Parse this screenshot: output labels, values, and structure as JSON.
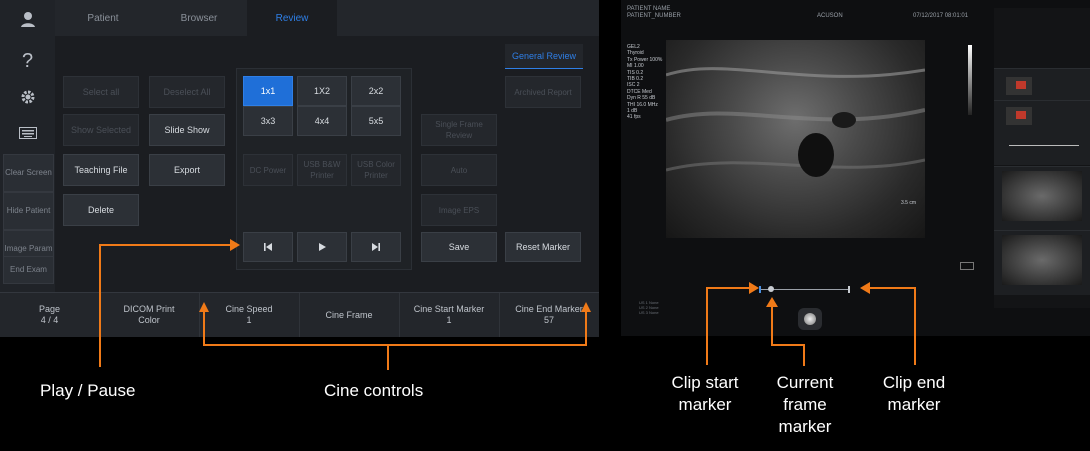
{
  "left_ui": {
    "tabs": [
      "Patient",
      "Browser",
      "Review"
    ],
    "active_tab": "Review",
    "general_review": "General Review",
    "sidebar": {
      "icons": [
        "user-icon",
        "help-icon",
        "gear-icon",
        "keyboard-icon"
      ],
      "buttons": [
        "Clear Screen",
        "Hide Patient",
        "Image Param",
        "End Exam"
      ]
    },
    "buttons": {
      "select_all": "Select all",
      "deselect_all": "Deselect All",
      "show_selected": "Show Selected",
      "slide_show": "Slide Show",
      "teaching_file": "Teaching File",
      "export": "Export",
      "delete": "Delete",
      "archived_report": "Archived Report",
      "save": "Save",
      "reset_marker": "Reset Marker"
    },
    "layout_buttons": [
      "1x1",
      "1X2",
      "2x2",
      "3x3",
      "4x4",
      "5x5"
    ],
    "dim_buttons": [
      "DC Power",
      "USB B&W Printer",
      "USB Color Printer"
    ],
    "right_dim": [
      "Single Frame Review",
      "Auto",
      "Image EPS"
    ],
    "cine_buttons": [
      "skip-back-icon",
      "play-icon",
      "skip-forward-icon"
    ],
    "bottom": [
      {
        "label": "Page",
        "value": "4 / 4"
      },
      {
        "label": "DICOM Print",
        "value": "Color"
      },
      {
        "label": "Cine Speed",
        "value": "1"
      },
      {
        "label": "Cine Frame",
        "value": ""
      },
      {
        "label": "Cine Start Marker",
        "value": "1"
      },
      {
        "label": "Cine End Marker",
        "value": "57"
      }
    ]
  },
  "annotations": {
    "play_pause": "Play / Pause",
    "cine_controls": "Cine controls",
    "clip_start": "Clip start marker",
    "current_frame": "Current frame marker",
    "clip_end": "Clip end marker"
  },
  "right_ui": {
    "patient_name": "PATIENT NAME",
    "patient_number": "PATIENT_NUMBER",
    "brand": "ACUSON",
    "datetime": "07/12/2017 08:01:01",
    "params": [
      "GEL2",
      "Thyroid",
      "Tx Power 100%",
      "MI 1.00",
      "TIS 0.2",
      "TIB 0.2",
      "ISC 2",
      "DTCE Med",
      "Dyn R 55 dB",
      "THI 16.0 MHz",
      "1 dB",
      "41 fps"
    ],
    "depth": "3.5 cm",
    "legend": [
      "US 1 None",
      "US 2 None",
      "US 3 None"
    ]
  },
  "accent": "#f07a18",
  "blue": "#1f6fd8"
}
